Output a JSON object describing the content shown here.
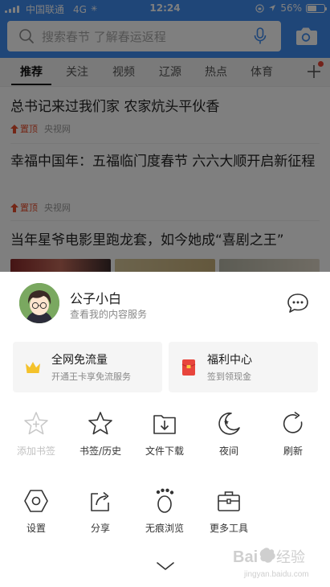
{
  "status": {
    "carrier": "中国联通",
    "network": "4G",
    "time": "12:24",
    "battery": "56%",
    "battery_level": 0.56
  },
  "search": {
    "placeholder": "搜索春节 了解春运返程"
  },
  "tabs": [
    "推荐",
    "关注",
    "视频",
    "辽源",
    "热点",
    "体育"
  ],
  "feed": {
    "articles": [
      {
        "title": "总书记来过我们家 农家炕头平伙香",
        "pinned": "置顶",
        "source": "央视网"
      },
      {
        "title": "幸福中国年：五福临门度春节 六六大顺开启新征程",
        "pinned": "置顶",
        "source": "央视网"
      },
      {
        "title": "当年星爷电影里跑龙套，如今她成“喜剧之王”"
      }
    ]
  },
  "profile": {
    "name": "公子小白",
    "subtitle": "查看我的内容服务"
  },
  "cards": [
    {
      "title": "全网免流量",
      "subtitle": "开通王卡享免流服务",
      "icon": "crown-icon"
    },
    {
      "title": "福利中心",
      "subtitle": "签到领现金",
      "icon": "red-envelope-icon"
    }
  ],
  "tools": [
    {
      "label": "添加书签",
      "icon": "add-bookmark-icon",
      "disabled": true
    },
    {
      "label": "书签/历史",
      "icon": "star-icon"
    },
    {
      "label": "文件下载",
      "icon": "download-folder-icon"
    },
    {
      "label": "夜间",
      "icon": "moon-icon"
    },
    {
      "label": "刷新",
      "icon": "refresh-icon"
    },
    {
      "label": "设置",
      "icon": "settings-hexagon-icon"
    },
    {
      "label": "分享",
      "icon": "share-icon"
    },
    {
      "label": "无痕浏览",
      "icon": "footprint-icon"
    },
    {
      "label": "更多工具",
      "icon": "toolbox-icon"
    }
  ],
  "watermark": {
    "brand": "Baidu 经验",
    "url": "jingyan.baidu.com"
  },
  "colors": {
    "header": "#3f8cf0",
    "pin": "#e94f2e",
    "crown": "#f4c22b",
    "envelope": "#e8453c"
  }
}
